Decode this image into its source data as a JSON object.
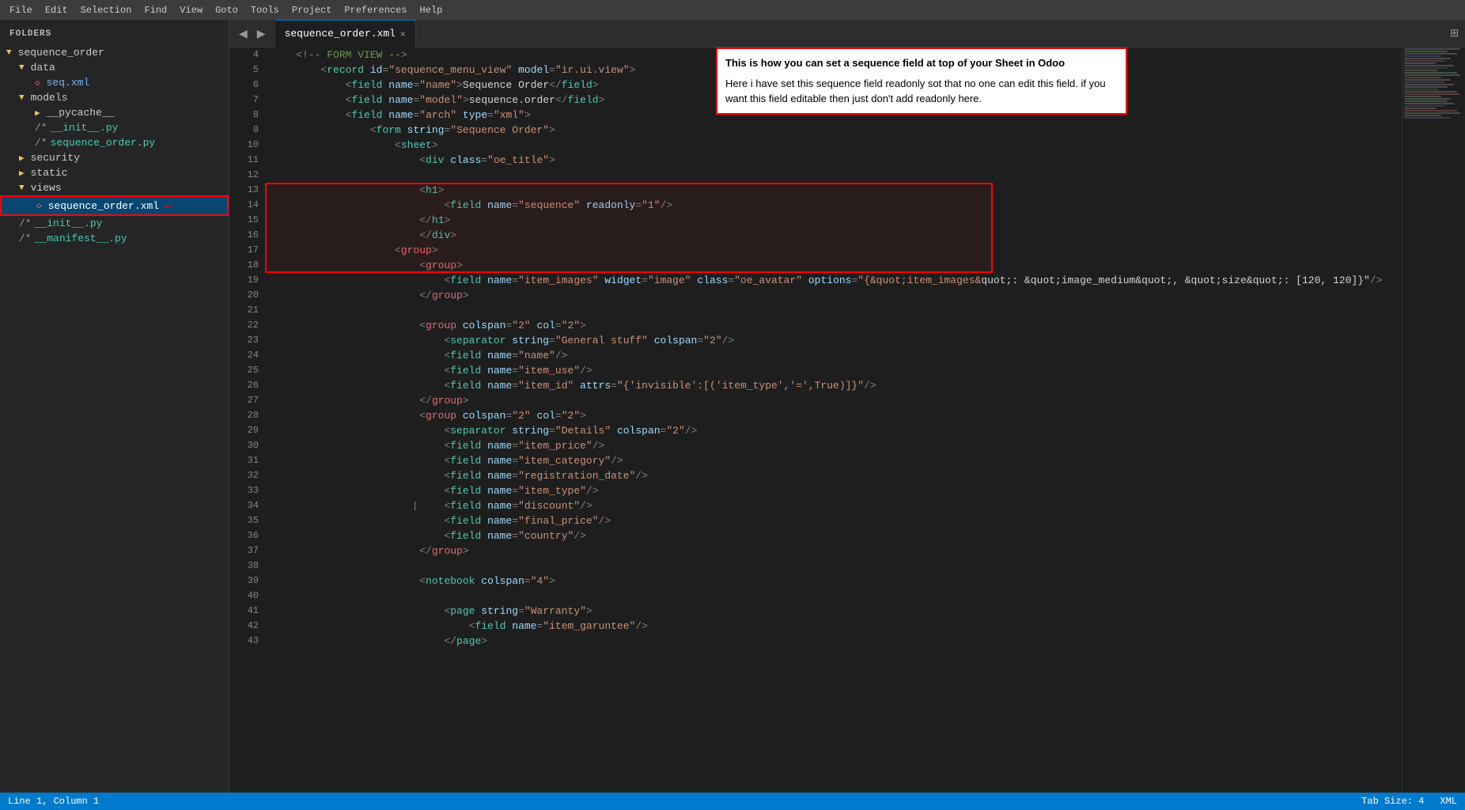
{
  "menubar": {
    "items": [
      "File",
      "Edit",
      "Selection",
      "Find",
      "View",
      "Goto",
      "Tools",
      "Project",
      "Preferences",
      "Help"
    ]
  },
  "sidebar": {
    "title": "FOLDERS",
    "tree": [
      {
        "id": "sequence_order",
        "label": "sequence_order",
        "type": "folder",
        "level": 0,
        "expanded": true
      },
      {
        "id": "data",
        "label": "data",
        "type": "folder",
        "level": 1,
        "expanded": true
      },
      {
        "id": "seq.xml",
        "label": "seq.xml",
        "type": "xml",
        "level": 2
      },
      {
        "id": "models",
        "label": "models",
        "type": "folder",
        "level": 1,
        "expanded": true
      },
      {
        "id": "__pycache__",
        "label": "__pycache__",
        "type": "folder",
        "level": 2,
        "expanded": false
      },
      {
        "id": "__init__.py",
        "label": "* __init__.py",
        "type": "py",
        "level": 2
      },
      {
        "id": "sequence_order.py",
        "label": "sequence_order.py",
        "type": "py",
        "level": 2
      },
      {
        "id": "security",
        "label": "security",
        "type": "folder",
        "level": 1,
        "expanded": false
      },
      {
        "id": "static",
        "label": "static",
        "type": "folder",
        "level": 1,
        "expanded": false
      },
      {
        "id": "views",
        "label": "views",
        "type": "folder",
        "level": 1,
        "expanded": true
      },
      {
        "id": "sequence_order.xml",
        "label": "◇ sequence_order.xml",
        "type": "xml",
        "level": 2,
        "selected": true
      },
      {
        "id": "__init__.py2",
        "label": "/* __init__.py",
        "type": "py",
        "level": 1
      },
      {
        "id": "__manifest__.py",
        "label": "/* __manifest__.py",
        "type": "py",
        "level": 1
      }
    ]
  },
  "tabs": {
    "items": [
      {
        "label": "sequence_order.xml",
        "active": true,
        "closeable": true
      }
    ]
  },
  "annotation": {
    "title": "This is how you can set a sequence field at top of your Sheet in Odoo",
    "body": "Here i have set this sequence field readonly sot that no one can edit this field. if you want this field editable then just don't add readonly here."
  },
  "statusbar": {
    "left": "Line 1, Column 1",
    "tab_size": "Tab Size: 4",
    "language": "XML"
  },
  "code": {
    "lines": [
      {
        "num": 4,
        "content": "    <!-- FORM VIEW -->"
      },
      {
        "num": 5,
        "content": "        <record id=\"sequence_menu_view\" model=\"ir.ui.view\">"
      },
      {
        "num": 6,
        "content": "            <field name=\"name\">Sequence Order</field>"
      },
      {
        "num": 7,
        "content": "            <field name=\"model\">sequence.order</field>"
      },
      {
        "num": 8,
        "content": "            <field name=\"arch\" type=\"xml\">"
      },
      {
        "num": 9,
        "content": "                <form string=\"Sequence Order\">"
      },
      {
        "num": 10,
        "content": "                    <sheet>"
      },
      {
        "num": 11,
        "content": "                        <div class=\"oe_title\">"
      },
      {
        "num": 12,
        "content": ""
      },
      {
        "num": 13,
        "content": "                        <h1>"
      },
      {
        "num": 14,
        "content": "                            <field name=\"sequence\" readonly=\"1\"/>"
      },
      {
        "num": 15,
        "content": "                        </h1>"
      },
      {
        "num": 16,
        "content": "                        </div>"
      },
      {
        "num": 17,
        "content": "                    <group>"
      },
      {
        "num": 18,
        "content": "                        <group>"
      },
      {
        "num": 19,
        "content": "                            <field name=\"item_images\" widget=\"image\" class=\"oe_avatar\" options=\"{&quot;item_images&quot;: &quot;image_medium&quot;, &quot;size&quot;: [120, 120]}\"/>"
      },
      {
        "num": 20,
        "content": "                        </group>"
      },
      {
        "num": 21,
        "content": ""
      },
      {
        "num": 22,
        "content": "                        <group colspan=\"2\" col=\"2\">"
      },
      {
        "num": 23,
        "content": "                            <separator string=\"General stuff\" colspan=\"2\"/>"
      },
      {
        "num": 24,
        "content": "                            <field name=\"name\"/>"
      },
      {
        "num": 25,
        "content": "                            <field name=\"item_use\"/>"
      },
      {
        "num": 26,
        "content": "                            <field name=\"item_id\" attrs=\"{'invisible':[('item_type','=',True)]}\"/>"
      },
      {
        "num": 27,
        "content": "                        </group>"
      },
      {
        "num": 28,
        "content": "                        <group colspan=\"2\" col=\"2\">"
      },
      {
        "num": 29,
        "content": "                            <separator string=\"Details\" colspan=\"2\"/>"
      },
      {
        "num": 30,
        "content": "                            <field name=\"item_price\"/>"
      },
      {
        "num": 31,
        "content": "                            <field name=\"item_category\"/>"
      },
      {
        "num": 32,
        "content": "                            <field name=\"registration_date\"/>"
      },
      {
        "num": 33,
        "content": "                            <field name=\"item_type\"/>"
      },
      {
        "num": 34,
        "content": "                            <field name=\"discount\"/>"
      },
      {
        "num": 35,
        "content": "                            <field name=\"final_price\"/>"
      },
      {
        "num": 36,
        "content": "                            <field name=\"country\"/>"
      },
      {
        "num": 37,
        "content": "                        </group>"
      },
      {
        "num": 38,
        "content": ""
      },
      {
        "num": 39,
        "content": "                        <notebook colspan=\"4\">"
      },
      {
        "num": 40,
        "content": ""
      },
      {
        "num": 41,
        "content": "                            <page string=\"Warranty\">"
      },
      {
        "num": 42,
        "content": "                                <field name=\"item_garuntee\"/>"
      },
      {
        "num": 43,
        "content": "                            </page>"
      }
    ]
  }
}
